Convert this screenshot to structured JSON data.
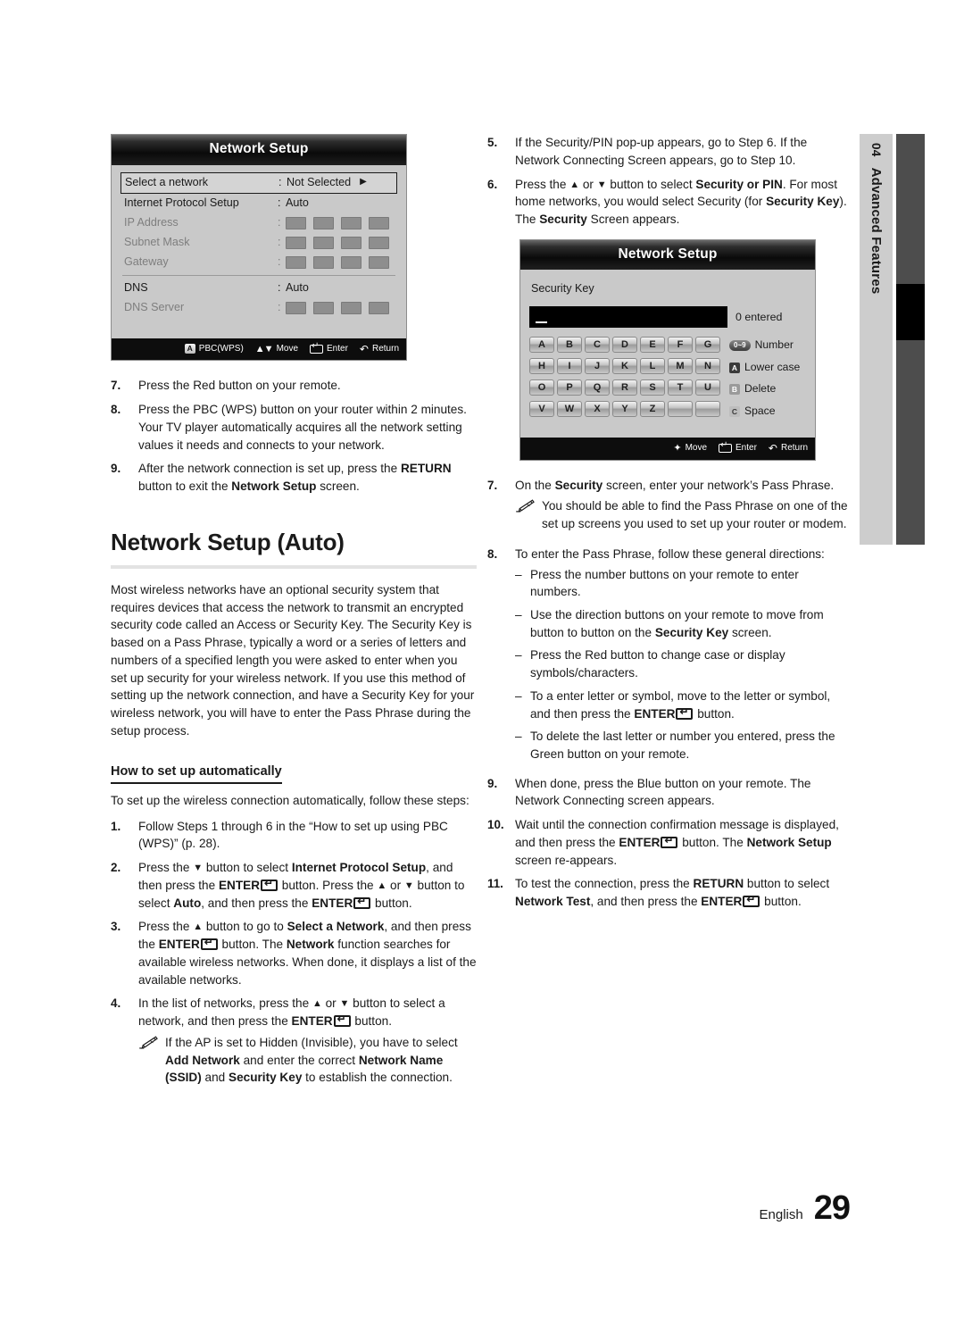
{
  "sidetab": {
    "number": "04",
    "label": "Advanced Features"
  },
  "footer": {
    "language": "English",
    "page_number": "29"
  },
  "osd_network_setup": {
    "title": "Network Setup",
    "rows": [
      {
        "label": "Select a network",
        "value": "Not Selected"
      },
      {
        "label": "Internet Protocol Setup",
        "value": "Auto"
      },
      {
        "label": "IP Address",
        "value": ""
      },
      {
        "label": "Subnet Mask",
        "value": ""
      },
      {
        "label": "Gateway",
        "value": ""
      },
      {
        "label": "DNS",
        "value": "Auto"
      },
      {
        "label": "DNS Server",
        "value": ""
      }
    ],
    "footer_items": [
      {
        "key": "A",
        "label": "PBC(WPS)"
      },
      {
        "key": "move",
        "label": "Move"
      },
      {
        "key": "enter",
        "label": "Enter"
      },
      {
        "key": "return",
        "label": "Return"
      }
    ]
  },
  "osd_security_key": {
    "title": "Network Setup",
    "field_label": "Security Key",
    "entered_count": "0 entered",
    "keys": [
      "A",
      "B",
      "C",
      "D",
      "E",
      "F",
      "G",
      "H",
      "I",
      "J",
      "K",
      "L",
      "M",
      "N",
      "O",
      "P",
      "Q",
      "R",
      "S",
      "T",
      "U",
      "V",
      "W",
      "X",
      "Y",
      "Z",
      "",
      ""
    ],
    "side_items": [
      {
        "badge": "0~9",
        "label": "Number"
      },
      {
        "badge": "A",
        "label": "Lower case"
      },
      {
        "badge": "B",
        "label": "Delete"
      },
      {
        "badge": "C",
        "label": "Space"
      }
    ],
    "footer_items": [
      {
        "key": "move",
        "label": "Move"
      },
      {
        "key": "enter",
        "label": "Enter"
      },
      {
        "key": "return",
        "label": "Return"
      }
    ]
  },
  "left_column": {
    "step7_num": "7.",
    "step7_text": "Press the Red button on your remote.",
    "step8_num": "8.",
    "step8_text": "Press the PBC (WPS) button on your router within 2 minutes. Your TV player automatically acquires all the network setting values it needs and connects to your network.",
    "step9_num": "9.",
    "step9_a": "After the network connection is set up, press the ",
    "step9_return": "RETURN",
    "step9_b": " button to exit the ",
    "step9_netsetup": "Network Setup",
    "step9_c": " screen.",
    "heading": "Network Setup (Auto)",
    "intro": "Most wireless networks have an optional security system that requires devices that access the network to transmit an encrypted security code called an Access or Security Key. The Security Key is based on a Pass Phrase, typically a word or a series of letters and numbers of a specified length you were asked to enter when you set up security for your wireless network.  If you use this method of setting up the network connection, and have a Security Key for your wireless network, you will have to enter the Pass Phrase during the setup process.",
    "subheading": "How to set up automatically",
    "lead": "To set up the wireless connection automatically, follow these steps:",
    "s1_num": "1.",
    "s1_text": "Follow Steps 1 through 6 in the “How to set up using PBC (WPS)” (p. 28).",
    "s2_num": "2.",
    "s2_a": "Press the ",
    "s2_b": " button to select ",
    "s2_ips": "Internet Protocol Setup",
    "s2_c": ", and then press the ",
    "s2_enter": "ENTER",
    "s2_d": " button. Press the ",
    "s2_e": " or ",
    "s2_f": " button to select ",
    "s2_auto": "Auto",
    "s2_g": ", and then press the ",
    "s2_enter2": "ENTER",
    "s2_h": " button.",
    "s3_num": "3.",
    "s3_a": "Press the ",
    "s3_b": " button to go to ",
    "s3_san": "Select a Network",
    "s3_c": ", and then press the ",
    "s3_enter": "ENTER",
    "s3_d": " button. The ",
    "s3_network": "Network",
    "s3_e": " function searches for available wireless networks. When done, it displays a list of the available networks.",
    "s4_num": "4.",
    "s4_a": "In the list of networks, press the ",
    "s4_b": " or ",
    "s4_c": " button to select a network, and then press the ",
    "s4_enter": "ENTER",
    "s4_d": " button.",
    "s4_note_a": "If the AP is set to Hidden (Invisible), you have to select ",
    "s4_note_add": "Add Network",
    "s4_note_b": " and enter the correct ",
    "s4_note_ssid": "Network Name (SSID)",
    "s4_note_c": " and ",
    "s4_note_key": "Security Key",
    "s4_note_d": " to establish the connection."
  },
  "right_column": {
    "s5_num": "5.",
    "s5_text": "If the Security/PIN pop-up appears, go to Step 6. If the Network Connecting Screen appears, go to Step 10.",
    "s6_num": "6.",
    "s6_a": "Press the ",
    "s6_b": " or ",
    "s6_c": " button to select ",
    "s6_secpin": "Security or PIN",
    "s6_d": ". For most home networks, you would select Security (for ",
    "s6_seckey": "Security Key",
    "s6_e": "). The ",
    "s6_security": "Security",
    "s6_f": " Screen appears.",
    "s7_num": "7.",
    "s7_a": "On the ",
    "s7_security": "Security",
    "s7_b": " screen, enter your network’s Pass Phrase.",
    "s7_note": "You should be able to find the Pass Phrase on one of the set up screens you used to set up your router or modem.",
    "s8_num": "8.",
    "s8_text": "To enter the Pass Phrase, follow these general directions:",
    "d1": "Press the number buttons on your remote to enter numbers.",
    "d2_a": "Use the direction buttons on your remote to move from button to button on the ",
    "d2_key": "Security Key",
    "d2_b": " screen.",
    "d3": "Press the Red button to change case or display symbols/characters.",
    "d4_a": "To a enter letter or symbol, move to the letter or symbol, and then press the ",
    "d4_enter": "ENTER",
    "d4_b": " button.",
    "d5": "To delete the last letter or number you entered, press the Green button on your remote.",
    "s9_num": "9.",
    "s9_text": "When done, press the Blue button on your remote. The Network Connecting screen appears.",
    "s10_num": "10.",
    "s10_a": "Wait until the connection confirmation message is displayed, and then press the ",
    "s10_enter": "ENTER",
    "s10_b": " button. The ",
    "s10_netsetup": "Network Setup",
    "s10_c": " screen re-appears.",
    "s11_num": "11.",
    "s11_a": "To test the connection, press the ",
    "s11_return": "RETURN",
    "s11_b": " button to select ",
    "s11_nettest": "Network Test",
    "s11_c": ", and then press the ",
    "s11_enter": "ENTER",
    "s11_d": " button."
  }
}
